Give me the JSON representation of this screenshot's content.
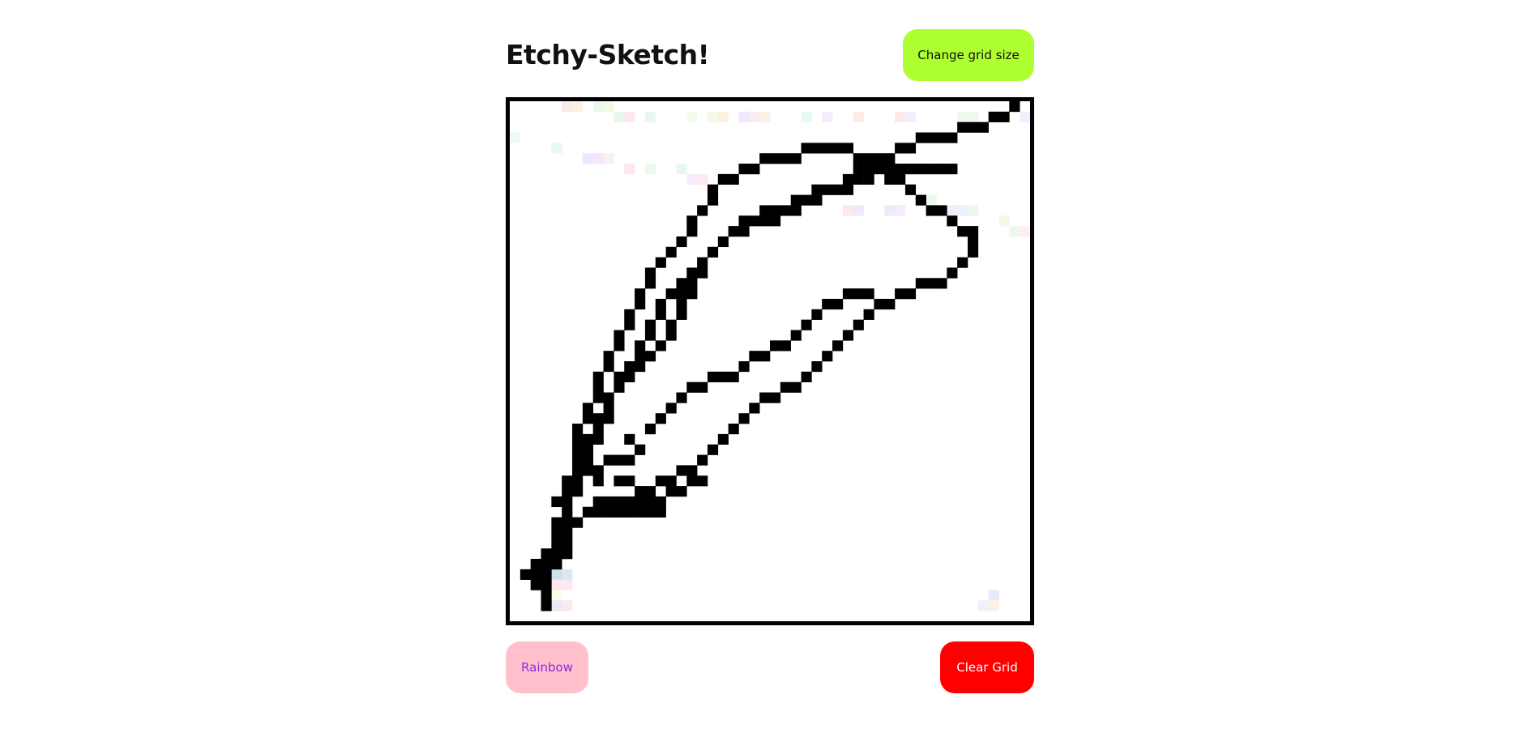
{
  "header": {
    "title": "Etchy-Sketch!",
    "grid_size_button": "Change grid size"
  },
  "footer": {
    "rainbow_button": "Rainbow",
    "clear_button": "Clear Grid"
  },
  "colors": {
    "grid_size_button_bg": "#adff2f",
    "rainbow_button_bg": "#ffc0cb",
    "rainbow_button_text": "#8a2be2",
    "clear_button_bg": "#ff0000",
    "ink": "#000000"
  },
  "grid": {
    "size": 50,
    "ink_color": "#000000",
    "filled_cells": [
      [
        1,
        45
      ],
      [
        2,
        45
      ],
      [
        2,
        46
      ],
      [
        3,
        44
      ],
      [
        3,
        45
      ],
      [
        3,
        46
      ],
      [
        3,
        47
      ],
      [
        3,
        48
      ],
      [
        4,
        43
      ],
      [
        4,
        44
      ],
      [
        5,
        42
      ],
      [
        5,
        43
      ],
      [
        4,
        38
      ],
      [
        5,
        38
      ],
      [
        5,
        39
      ],
      [
        6,
        35
      ],
      [
        6,
        36
      ],
      [
        6,
        37
      ],
      [
        7,
        34
      ],
      [
        7,
        35
      ],
      [
        8,
        31
      ],
      [
        8,
        32
      ],
      [
        9,
        29
      ],
      [
        9,
        30
      ],
      [
        9,
        28
      ],
      [
        10,
        27
      ],
      [
        10,
        26
      ],
      [
        11,
        25
      ],
      [
        12,
        24
      ],
      [
        12,
        23
      ],
      [
        13,
        22
      ],
      [
        13,
        21
      ],
      [
        14,
        20
      ],
      [
        14,
        19
      ],
      [
        15,
        18
      ],
      [
        16,
        18
      ],
      [
        16,
        17
      ],
      [
        17,
        16
      ],
      [
        18,
        15
      ],
      [
        19,
        14
      ],
      [
        20,
        13
      ],
      [
        21,
        12
      ],
      [
        22,
        12
      ],
      [
        23,
        11
      ],
      [
        24,
        11
      ],
      [
        25,
        11
      ],
      [
        26,
        10
      ],
      [
        27,
        10
      ],
      [
        28,
        9
      ],
      [
        29,
        9
      ],
      [
        30,
        8
      ],
      [
        31,
        8
      ],
      [
        32,
        7
      ],
      [
        33,
        7
      ],
      [
        34,
        6
      ],
      [
        35,
        5
      ],
      [
        36,
        5
      ],
      [
        37,
        4
      ],
      [
        38,
        4
      ],
      [
        39,
        3
      ],
      [
        40,
        3
      ],
      [
        41,
        3
      ],
      [
        42,
        3
      ],
      [
        43,
        2
      ],
      [
        44,
        2
      ],
      [
        45,
        2
      ],
      [
        46,
        1
      ],
      [
        47,
        1
      ],
      [
        48,
        0
      ],
      [
        4,
        41
      ],
      [
        5,
        40
      ],
      [
        5,
        37
      ],
      [
        6,
        33
      ],
      [
        6,
        32
      ],
      [
        6,
        31
      ],
      [
        7,
        30
      ],
      [
        7,
        29
      ],
      [
        8,
        28
      ],
      [
        8,
        27
      ],
      [
        8,
        26
      ],
      [
        9,
        25
      ],
      [
        9,
        24
      ],
      [
        10,
        23
      ],
      [
        10,
        22
      ],
      [
        11,
        21
      ],
      [
        11,
        20
      ],
      [
        12,
        19
      ],
      [
        12,
        18
      ],
      [
        13,
        17
      ],
      [
        13,
        16
      ],
      [
        14,
        15
      ],
      [
        15,
        14
      ],
      [
        16,
        13
      ],
      [
        17,
        12
      ],
      [
        17,
        11
      ],
      [
        18,
        10
      ],
      [
        19,
        9
      ],
      [
        19,
        8
      ],
      [
        20,
        7
      ],
      [
        21,
        7
      ],
      [
        22,
        6
      ],
      [
        23,
        6
      ],
      [
        24,
        5
      ],
      [
        25,
        5
      ],
      [
        26,
        5
      ],
      [
        27,
        5
      ],
      [
        28,
        4
      ],
      [
        29,
        4
      ],
      [
        30,
        4
      ],
      [
        31,
        4
      ],
      [
        32,
        4
      ],
      [
        33,
        5
      ],
      [
        33,
        6
      ],
      [
        34,
        5
      ],
      [
        35,
        5
      ],
      [
        36,
        6
      ],
      [
        36,
        7
      ],
      [
        37,
        7
      ],
      [
        38,
        8
      ],
      [
        39,
        9
      ],
      [
        40,
        10
      ],
      [
        41,
        10
      ],
      [
        42,
        11
      ],
      [
        43,
        12
      ],
      [
        44,
        12
      ],
      [
        44,
        13
      ],
      [
        44,
        14
      ],
      [
        43,
        15
      ],
      [
        42,
        16
      ],
      [
        41,
        17
      ],
      [
        40,
        17
      ],
      [
        39,
        17
      ],
      [
        38,
        18
      ],
      [
        37,
        18
      ],
      [
        36,
        19
      ],
      [
        35,
        19
      ],
      [
        34,
        20
      ],
      [
        33,
        21
      ],
      [
        32,
        22
      ],
      [
        31,
        23
      ],
      [
        30,
        24
      ],
      [
        29,
        25
      ],
      [
        28,
        26
      ],
      [
        27,
        27
      ],
      [
        26,
        27
      ],
      [
        25,
        28
      ],
      [
        24,
        28
      ],
      [
        23,
        29
      ],
      [
        22,
        30
      ],
      [
        21,
        31
      ],
      [
        20,
        32
      ],
      [
        19,
        33
      ],
      [
        18,
        34
      ],
      [
        17,
        35
      ],
      [
        16,
        35
      ],
      [
        15,
        36
      ],
      [
        14,
        36
      ],
      [
        13,
        37
      ],
      [
        12,
        38
      ],
      [
        11,
        38
      ],
      [
        10,
        38
      ],
      [
        9,
        38
      ],
      [
        8,
        38
      ],
      [
        7,
        39
      ],
      [
        6,
        40
      ],
      [
        5,
        41
      ],
      [
        4,
        42
      ],
      [
        3,
        43
      ],
      [
        2,
        44
      ],
      [
        10,
        36
      ],
      [
        11,
        36
      ],
      [
        12,
        37
      ],
      [
        13,
        38
      ],
      [
        14,
        38
      ],
      [
        15,
        37
      ],
      [
        16,
        37
      ],
      [
        17,
        36
      ],
      [
        18,
        36
      ],
      [
        8,
        39
      ],
      [
        9,
        39
      ],
      [
        10,
        39
      ],
      [
        11,
        39
      ],
      [
        12,
        39
      ],
      [
        13,
        39
      ],
      [
        14,
        39
      ],
      [
        4,
        40
      ],
      [
        5,
        36
      ],
      [
        6,
        34
      ],
      [
        7,
        33
      ],
      [
        7,
        32
      ],
      [
        8,
        30
      ],
      [
        9,
        29
      ],
      [
        10,
        27
      ],
      [
        11,
        26
      ],
      [
        12,
        25
      ],
      [
        13,
        24
      ],
      [
        14,
        23
      ],
      [
        15,
        22
      ],
      [
        15,
        21
      ],
      [
        16,
        20
      ],
      [
        16,
        19
      ],
      [
        17,
        18
      ],
      [
        17,
        17
      ],
      [
        18,
        16
      ],
      [
        18,
        15
      ],
      [
        19,
        14
      ],
      [
        20,
        13
      ],
      [
        21,
        12
      ],
      [
        22,
        11
      ],
      [
        23,
        11
      ],
      [
        24,
        10
      ],
      [
        25,
        10
      ],
      [
        26,
        10
      ],
      [
        27,
        9
      ],
      [
        28,
        9
      ],
      [
        29,
        8
      ],
      [
        30,
        8
      ],
      [
        31,
        8
      ],
      [
        32,
        8
      ],
      [
        33,
        7
      ],
      [
        34,
        7
      ],
      [
        35,
        6
      ],
      [
        36,
        6
      ],
      [
        37,
        6
      ],
      [
        38,
        6
      ],
      [
        39,
        6
      ],
      [
        40,
        6
      ],
      [
        41,
        6
      ],
      [
        42,
        6
      ],
      [
        9,
        34
      ],
      [
        10,
        34
      ],
      [
        11,
        34
      ],
      [
        8,
        35
      ],
      [
        8,
        36
      ],
      [
        12,
        33
      ],
      [
        11,
        32
      ],
      [
        13,
        31
      ],
      [
        14,
        30
      ],
      [
        15,
        29
      ],
      [
        16,
        28
      ],
      [
        17,
        27
      ],
      [
        18,
        27
      ],
      [
        19,
        26
      ],
      [
        20,
        26
      ],
      [
        21,
        26
      ],
      [
        22,
        25
      ],
      [
        23,
        24
      ],
      [
        24,
        24
      ],
      [
        25,
        23
      ],
      [
        26,
        23
      ],
      [
        27,
        22
      ],
      [
        28,
        21
      ],
      [
        29,
        20
      ],
      [
        30,
        19
      ],
      [
        31,
        19
      ],
      [
        32,
        18
      ],
      [
        33,
        18
      ],
      [
        34,
        18
      ]
    ],
    "tint_cells": [
      [
        5,
        0,
        "#fde8ec"
      ],
      [
        6,
        0,
        "#fdf1e6"
      ],
      [
        8,
        0,
        "#e8f8ee"
      ],
      [
        9,
        0,
        "#f4f9e7"
      ],
      [
        10,
        1,
        "#e6f8ec"
      ],
      [
        11,
        1,
        "#fde8ec"
      ],
      [
        13,
        1,
        "#e8f8ee"
      ],
      [
        17,
        1,
        "#f3fbea"
      ],
      [
        19,
        1,
        "#f7f9e6"
      ],
      [
        20,
        1,
        "#fbf1e2"
      ],
      [
        22,
        1,
        "#f0e8fb"
      ],
      [
        23,
        1,
        "#fde9f1"
      ],
      [
        24,
        1,
        "#fdf1e6"
      ],
      [
        28,
        1,
        "#e8f8f4"
      ],
      [
        30,
        1,
        "#f6ebfd"
      ],
      [
        33,
        1,
        "#fdebe8"
      ],
      [
        37,
        1,
        "#fde8ec"
      ],
      [
        38,
        1,
        "#eef1fd"
      ],
      [
        43,
        1,
        "#eef9ee"
      ],
      [
        44,
        1,
        "#eef9ee"
      ],
      [
        48,
        0,
        "#f6edfd"
      ],
      [
        49,
        1,
        "#eef1fd"
      ],
      [
        0,
        3,
        "#eef8f4"
      ],
      [
        4,
        4,
        "#e6f8f4"
      ],
      [
        7,
        5,
        "#eae8fd"
      ],
      [
        8,
        5,
        "#f1e8fd"
      ],
      [
        9,
        5,
        "#fdeef1"
      ],
      [
        11,
        6,
        "#fde8ec"
      ],
      [
        13,
        6,
        "#eef9ee"
      ],
      [
        16,
        6,
        "#e8f8ee"
      ],
      [
        17,
        7,
        "#f6ebfd"
      ],
      [
        18,
        7,
        "#fde9f1"
      ],
      [
        20,
        7,
        "#f1e8fd"
      ],
      [
        21,
        7,
        "#f6ebfd"
      ],
      [
        40,
        9,
        "#eef9ee"
      ],
      [
        42,
        10,
        "#f6ebfd"
      ],
      [
        43,
        10,
        "#eef1fd"
      ],
      [
        44,
        10,
        "#e8f8ee"
      ],
      [
        47,
        11,
        "#f4f9e7"
      ],
      [
        48,
        12,
        "#eef9ee"
      ],
      [
        49,
        12,
        "#fdeef1"
      ],
      [
        4,
        45,
        "#cfe0e6"
      ],
      [
        5,
        45,
        "#d8e8f4"
      ],
      [
        4,
        46,
        "#fde8ec"
      ],
      [
        5,
        46,
        "#fde8f1"
      ],
      [
        4,
        47,
        "#fbfbe8"
      ],
      [
        4,
        48,
        "#eee8f8"
      ],
      [
        5,
        48,
        "#fde8ec"
      ],
      [
        45,
        48,
        "#eef1fd"
      ],
      [
        46,
        47,
        "#eae8fd"
      ],
      [
        46,
        48,
        "#fdf1e6"
      ],
      [
        32,
        10,
        "#fde8f1"
      ],
      [
        33,
        10,
        "#f1e8fd"
      ],
      [
        36,
        10,
        "#f1e8fd"
      ],
      [
        37,
        10,
        "#f6ebfd"
      ]
    ]
  }
}
